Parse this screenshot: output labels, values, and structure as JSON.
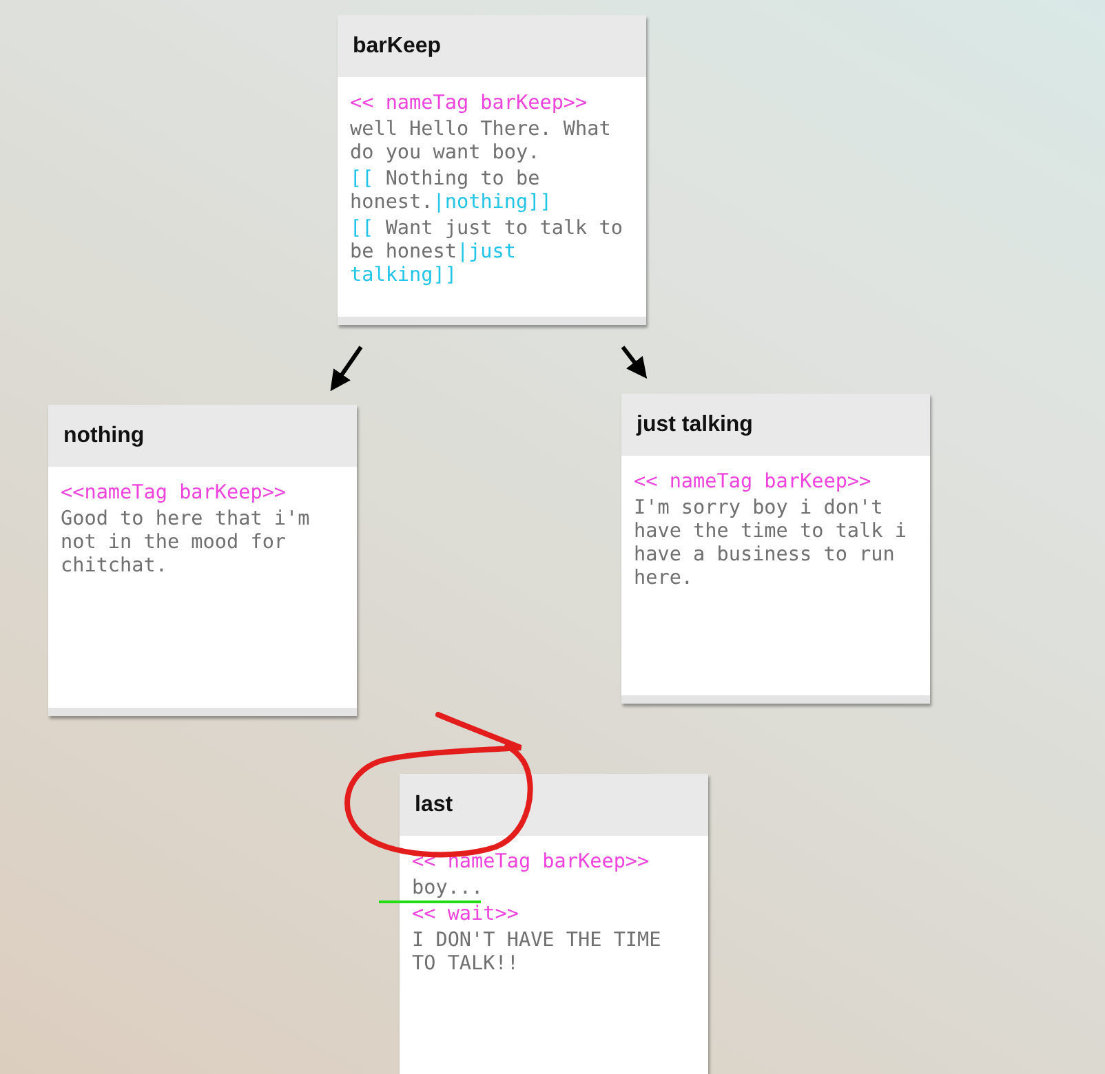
{
  "passages": [
    {
      "title": "barKeep",
      "lines": [
        [
          {
            "kind": "macro",
            "text": "<< nameTag barKeep>>"
          }
        ],
        [
          {
            "kind": "text",
            "text": "well Hello There. What do you want boy."
          }
        ],
        [
          {
            "kind": "link",
            "text": "[["
          },
          {
            "kind": "text",
            "text": " Nothing to be honest."
          },
          {
            "kind": "link",
            "text": "|nothing]]"
          }
        ],
        [
          {
            "kind": "link",
            "text": "[["
          },
          {
            "kind": "text",
            "text": " Want just to talk to be honest"
          },
          {
            "kind": "link",
            "text": "|just talking]]"
          }
        ]
      ]
    },
    {
      "title": "nothing",
      "lines": [
        [
          {
            "kind": "macro",
            "text": "<<nameTag barKeep>>"
          }
        ],
        [
          {
            "kind": "text",
            "text": "Good to here that i'm not in the mood for chitchat."
          }
        ]
      ]
    },
    {
      "title": "just talking",
      "lines": [
        [
          {
            "kind": "macro",
            "text": "<< nameTag barKeep>>"
          }
        ],
        [
          {
            "kind": "text",
            "text": "I'm sorry boy i don't have the time to talk i have a business to run here."
          }
        ]
      ]
    },
    {
      "title": "last",
      "lines": [
        [
          {
            "kind": "macro",
            "text": "<< nameTag barKeep>>"
          }
        ],
        [
          {
            "kind": "text",
            "text": "boy..."
          }
        ],
        [
          {
            "kind": "macro",
            "text": "<< wait>>"
          }
        ],
        [
          {
            "kind": "text",
            "text": "I DON'T HAVE THE TIME TO TALK!!"
          }
        ]
      ]
    }
  ]
}
